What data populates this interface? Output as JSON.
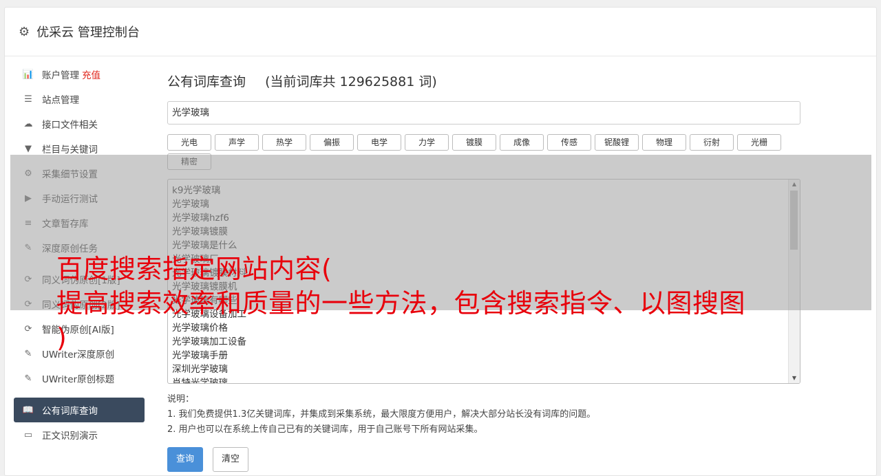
{
  "header": {
    "title": "优采云 管理控制台",
    "icon": "gear-icon"
  },
  "sidebar": {
    "items": [
      {
        "label": "账户管理",
        "badge": "充值",
        "icon": "bar-chart-icon",
        "glyph": "📊"
      },
      {
        "label": "站点管理",
        "icon": "server-icon",
        "glyph": "☰"
      },
      {
        "label": "接口文件相关",
        "icon": "cloud-upload-icon",
        "glyph": "☁"
      },
      {
        "label": "栏目与关键词",
        "icon": "filter-icon",
        "glyph": "▼"
      },
      {
        "label": "采集细节设置",
        "icon": "cogs-icon",
        "glyph": "⚙"
      },
      {
        "label": "手动运行测试",
        "icon": "play-circle-icon",
        "glyph": "▶"
      },
      {
        "label": "文章暂存库",
        "icon": "database-icon",
        "glyph": "≡"
      },
      {
        "label": "深度原创任务",
        "icon": "edit-icon",
        "glyph": "✎"
      },
      {
        "label": "同义词伪原创[1版]",
        "icon": "refresh-icon",
        "glyph": "⟳"
      },
      {
        "label": "同义词伪原创[2版]",
        "icon": "refresh-icon",
        "glyph": "⟳"
      },
      {
        "label": "智能伪原创[AI版]",
        "icon": "refresh-icon",
        "glyph": "⟳"
      },
      {
        "label": "UWriter深度原创",
        "icon": "edit-icon",
        "glyph": "✎"
      },
      {
        "label": "UWriter原创标题",
        "icon": "edit-icon",
        "glyph": "✎"
      },
      {
        "label": "公有词库查询",
        "icon": "book-icon",
        "glyph": "📖"
      },
      {
        "label": "正文识别演示",
        "icon": "monitor-icon",
        "glyph": "▭"
      }
    ]
  },
  "main": {
    "heading": "公有词库查询",
    "count_text": "(当前词库共 129625881 词)",
    "search_value": "光学玻璃",
    "tags": [
      "光电",
      "声学",
      "热学",
      "偏振",
      "电学",
      "力学",
      "镀膜",
      "成像",
      "传感",
      "铌酸锂",
      "物理",
      "衍射",
      "光栅",
      "精密"
    ],
    "results": [
      "k9光学玻璃",
      "光学玻璃",
      "光学玻璃hzf6",
      "光学玻璃镀膜",
      "光学玻璃是什么",
      "光学玻璃厂",
      "光学玻璃镀膜材料",
      "光学玻璃镀膜机",
      "光学玻璃有哪些",
      "光学玻璃设备加工",
      "光学玻璃价格",
      "光学玻璃加工设备",
      "光学玻璃手册",
      "深圳光学玻璃",
      "肖特光学玻璃"
    ],
    "notes_title": "说明：",
    "notes": [
      "1. 我们免费提供1.3亿关键词库，并集成到采集系统，最大限度方便用户，解决大部分站长没有词库的问题。",
      "2. 用户也可以在系统上传自己已有的关键词库，用于自己账号下所有网站采集。"
    ],
    "query_button": "查询",
    "clear_button": "清空"
  },
  "overlay_text": {
    "line1": "百度搜索指定网站内容(",
    "line2": "提高搜索效率和质量的一些方法，包含搜索指令、以图搜图",
    "line3": ")"
  }
}
